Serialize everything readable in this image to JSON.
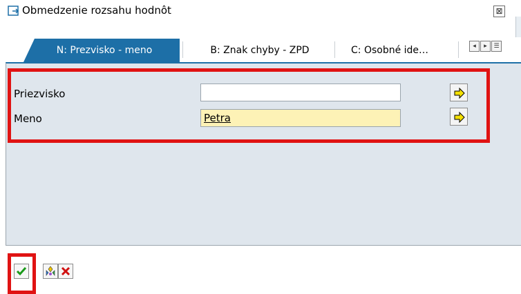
{
  "window": {
    "title": "Obmedzenie rozsahu hodnôt",
    "close_symbol": "⊠"
  },
  "tabs": [
    {
      "label": "N: Prezvisko - meno",
      "active": true
    },
    {
      "label": "B: Znak chyby - ZPD",
      "active": false
    },
    {
      "label": "C: Osobné ide…",
      "active": false
    }
  ],
  "tab_controls": [
    "◂",
    "▸",
    "☰"
  ],
  "form": {
    "rows": [
      {
        "label": "Priezvisko",
        "value": ""
      },
      {
        "label": "Meno",
        "value": "Petra"
      }
    ]
  },
  "toolbar": {
    "buttons": [
      "check-icon",
      "multi-select-icon",
      "cancel-icon"
    ]
  },
  "colors": {
    "accent": "#1d6fa7",
    "highlight_red": "#e01313",
    "required_yellow": "#fdf2b6",
    "panel": "#dfe6ed"
  }
}
